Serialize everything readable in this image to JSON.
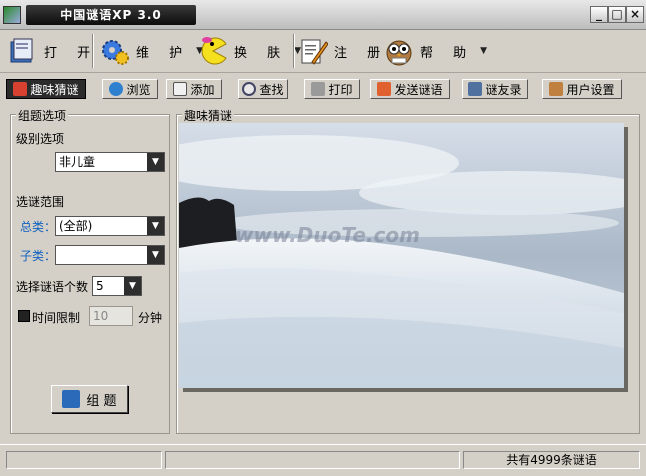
{
  "window": {
    "title": "中国谜语XP 3.0",
    "controls": {
      "minimize": "_",
      "maximize": "□",
      "close": "×"
    }
  },
  "menu": [
    {
      "label": "打 开",
      "icon": "folder-book-icon"
    },
    {
      "label": "维 护",
      "icon": "gears-icon"
    },
    {
      "label": "换 肤",
      "icon": "pacman-icon"
    },
    {
      "label": "注 册",
      "icon": "pen-paper-icon"
    },
    {
      "label": "帮 助",
      "icon": "owl-icon"
    }
  ],
  "toolbar": [
    {
      "label": "趣味猜谜",
      "icon": "puzzle-icon",
      "active": true
    },
    {
      "label": "浏览",
      "icon": "globe-icon"
    },
    {
      "label": "添加",
      "icon": "edit-icon"
    },
    {
      "label": "查找",
      "icon": "magnifier-icon"
    },
    {
      "label": "打印",
      "icon": "printer-icon"
    },
    {
      "label": "发送谜语",
      "icon": "send-icon"
    },
    {
      "label": "谜友录",
      "icon": "address-book-icon"
    },
    {
      "label": "用户设置",
      "icon": "settings-icon"
    }
  ],
  "left_panel": {
    "title": "组题选项",
    "level_label": "级别选项",
    "level_value": "非儿童",
    "range_label": "选谜范围",
    "category_label": "总类：",
    "category_value": "(全部)",
    "subcategory_label": "子类：",
    "subcategory_value": "",
    "count_label": "选择谜语个数",
    "count_value": "5",
    "time_limit_label": "时间限制",
    "time_limit_value": "10",
    "time_unit": "分钟",
    "compose_button": "组 题"
  },
  "right_panel": {
    "title": "趣味猜谜",
    "watermark": "www.DuoTe.com"
  },
  "status": {
    "count_text": "共有4999条谜语"
  },
  "colors": {
    "accent": "#1060c0",
    "titlebar_dark": "#1a1a1a"
  }
}
